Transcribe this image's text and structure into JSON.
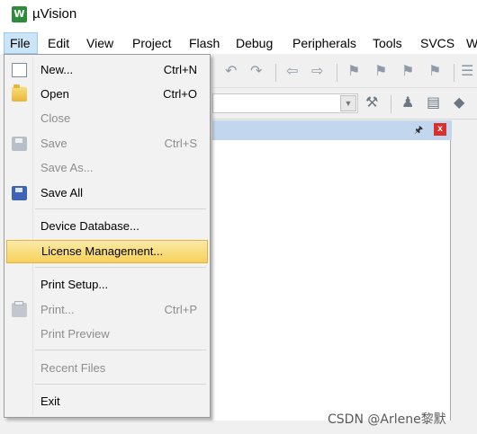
{
  "app": {
    "title": "µVision",
    "icon_text": "W"
  },
  "menubar": {
    "items": [
      {
        "label": "File"
      },
      {
        "label": "Edit"
      },
      {
        "label": "View"
      },
      {
        "label": "Project"
      },
      {
        "label": "Flash"
      },
      {
        "label": "Debug"
      },
      {
        "label": "Peripherals"
      },
      {
        "label": "Tools"
      },
      {
        "label": "SVCS"
      },
      {
        "label": "W"
      }
    ],
    "active": "File"
  },
  "file_menu": {
    "items": [
      {
        "label": "New...",
        "shortcut": "Ctrl+N",
        "enabled": true,
        "icon": "new-document-icon"
      },
      {
        "label": "Open",
        "shortcut": "Ctrl+O",
        "enabled": true,
        "icon": "open-folder-icon"
      },
      {
        "label": "Close",
        "shortcut": "",
        "enabled": false
      },
      {
        "label": "Save",
        "shortcut": "Ctrl+S",
        "enabled": false,
        "icon": "save-icon"
      },
      {
        "label": "Save As...",
        "shortcut": "",
        "enabled": false
      },
      {
        "label": "Save All",
        "shortcut": "",
        "enabled": true,
        "icon": "save-all-icon"
      },
      {
        "label": "Device Database...",
        "shortcut": "",
        "enabled": true
      },
      {
        "label": "License Management...",
        "shortcut": "",
        "enabled": true,
        "highlighted": true
      },
      {
        "label": "Print Setup...",
        "shortcut": "",
        "enabled": true
      },
      {
        "label": "Print...",
        "shortcut": "Ctrl+P",
        "enabled": false,
        "icon": "print-icon"
      },
      {
        "label": "Print Preview",
        "shortcut": "",
        "enabled": false
      },
      {
        "label": "Recent Files",
        "shortcut": "",
        "enabled": false
      },
      {
        "label": "Exit",
        "shortcut": "",
        "enabled": true
      }
    ]
  },
  "pane": {
    "pin_symbol": "🖈",
    "close_symbol": "x"
  },
  "watermark": "CSDN @Arlene黎默",
  "colors": {
    "highlight": "#f6d25b",
    "menu_active": "#cce4f7",
    "pane_header": "#c2d6ee",
    "close_button": "#d9302c"
  }
}
